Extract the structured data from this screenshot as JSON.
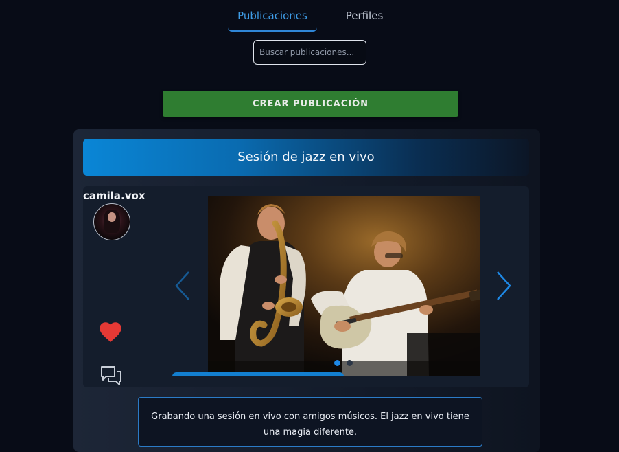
{
  "tabs": [
    {
      "label": "Publicaciones",
      "active": true
    },
    {
      "label": "Perfiles",
      "active": false
    }
  ],
  "search": {
    "placeholder": "Buscar publicaciones...",
    "value": ""
  },
  "create_button": {
    "label": "CREAR PUBLICACIÓN"
  },
  "post": {
    "title": "Sesión de jazz en vivo",
    "username": "camila.vox",
    "caption": "Grabando una sesión en vivo con amigos músicos. El jazz en vivo tiene una magia diferente.",
    "liked": true,
    "carousel": {
      "current_slide": 1,
      "total_slides": 2,
      "progress": 0.5
    }
  },
  "icons": {
    "like": "heart-icon",
    "comment": "comments-icon",
    "prev": "chevron-left-icon",
    "next": "chevron-right-icon"
  },
  "colors": {
    "background": "#080c17",
    "accent": "#1e88e5",
    "create_button": "#2f7d31",
    "heart": "#e53935"
  }
}
